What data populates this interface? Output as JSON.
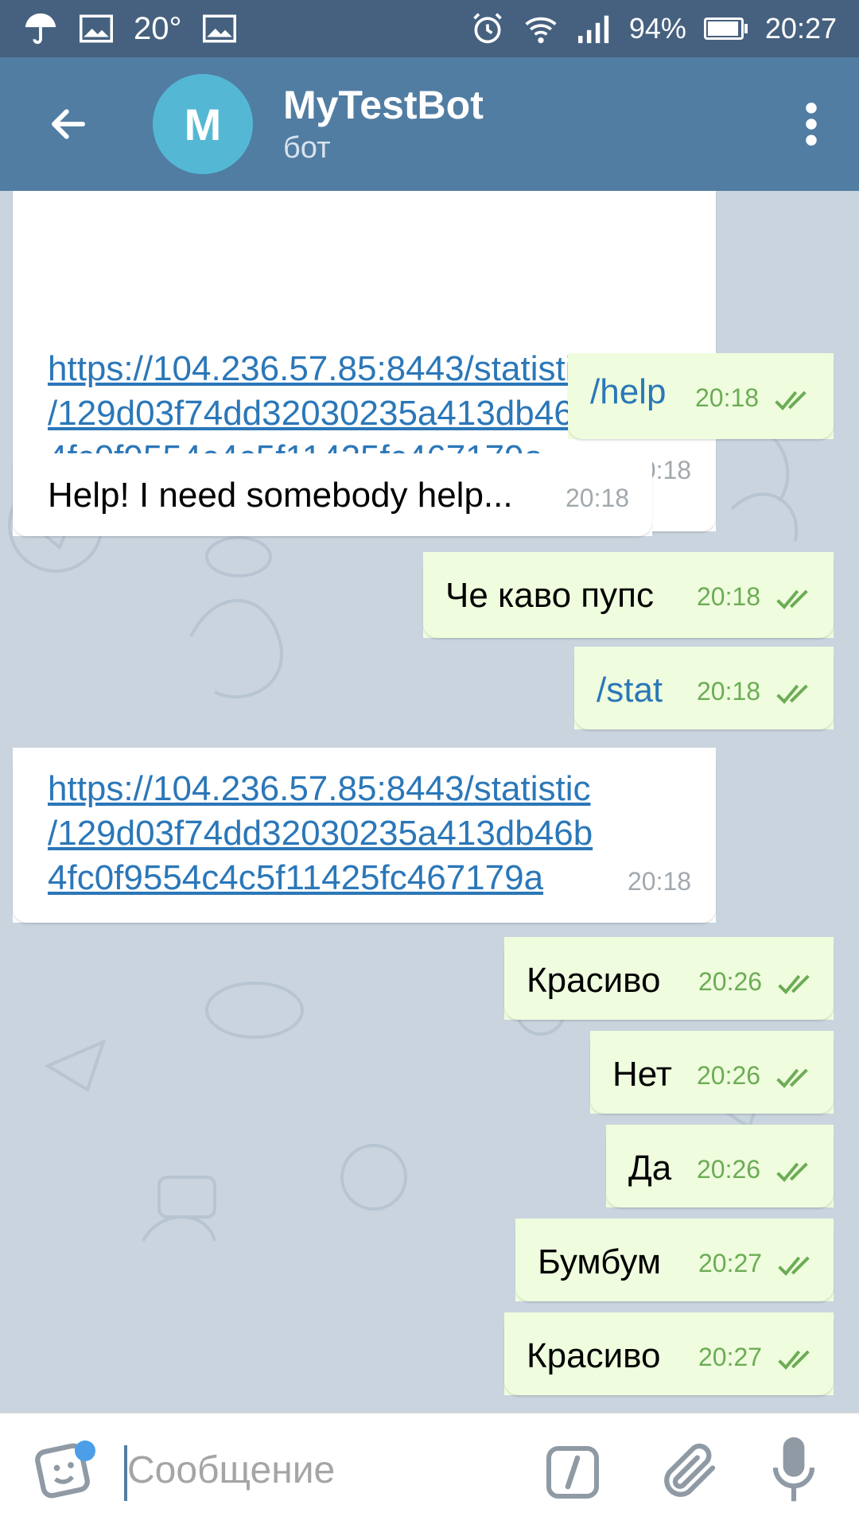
{
  "status_bar": {
    "temperature": "20°",
    "battery": "94%",
    "time": "20:27",
    "icons": [
      "umbrella-icon",
      "image-icon",
      "image-icon",
      "alarm-icon",
      "wifi-icon",
      "signal-icon",
      "battery-icon"
    ]
  },
  "header": {
    "avatar_letter": "M",
    "title": "MyTestBot",
    "subtitle": "бот",
    "back_icon": "arrow-left-icon",
    "menu_icon": "more-vert-icon"
  },
  "messages": [
    {
      "dir": "in",
      "lines": [
        "https://104.236.57.85:8443/statistic",
        "/129d03f74dd32030235a413db46b",
        "4fc0f9554c4c5f11425fc467179a"
      ],
      "time": "20:18",
      "kind": "link"
    },
    {
      "dir": "out",
      "text": "/help",
      "time": "20:18",
      "kind": "cmd"
    },
    {
      "dir": "in",
      "text": "Help! I need somebody help...",
      "time": "20:18"
    },
    {
      "dir": "out",
      "text": "Че каво пупс",
      "time": "20:18"
    },
    {
      "dir": "out",
      "text": "/stat",
      "time": "20:18",
      "kind": "cmd"
    },
    {
      "dir": "in",
      "lines": [
        "https://104.236.57.85:8443/statistic",
        "/129d03f74dd32030235a413db46b",
        "4fc0f9554c4c5f11425fc467179a"
      ],
      "time": "20:18",
      "kind": "link"
    },
    {
      "dir": "out",
      "text": "Красиво",
      "time": "20:26"
    },
    {
      "dir": "out",
      "text": "Нет",
      "time": "20:26"
    },
    {
      "dir": "out",
      "text": "Да",
      "time": "20:26"
    },
    {
      "dir": "out",
      "text": "Бумбум",
      "time": "20:27"
    },
    {
      "dir": "out",
      "text": "Красиво",
      "time": "20:27"
    }
  ],
  "input": {
    "placeholder": "Сообщение"
  },
  "colors": {
    "header": "#517da2",
    "status_bar": "#46617f",
    "incoming_bubble": "#ffffff",
    "outgoing_bubble": "#effdde",
    "link": "#2b77b8",
    "time_out": "#6cac55"
  }
}
